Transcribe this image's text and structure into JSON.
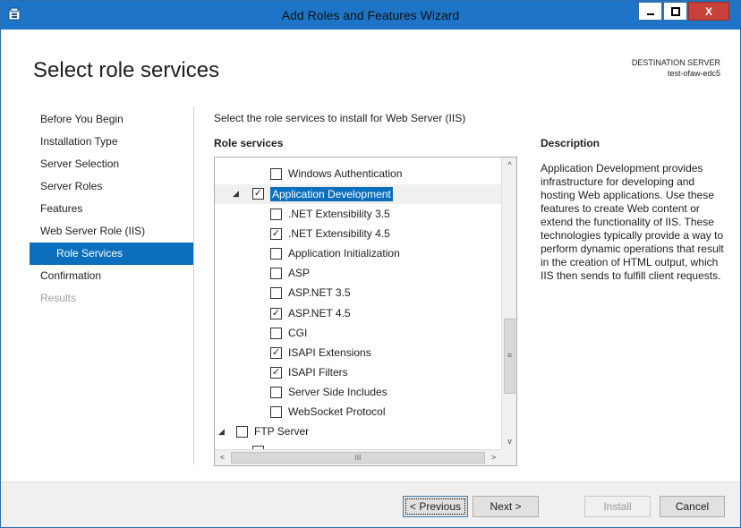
{
  "window": {
    "title": "Add Roles and Features Wizard",
    "min_label": "▁",
    "max_label": "☐",
    "close_label": "X"
  },
  "header": {
    "title": "Select role services",
    "destination_label": "DESTINATION SERVER",
    "destination_name": "test-ofaw-edc5"
  },
  "nav": {
    "items": [
      {
        "label": "Before You Begin"
      },
      {
        "label": "Installation Type"
      },
      {
        "label": "Server Selection"
      },
      {
        "label": "Server Roles"
      },
      {
        "label": "Features"
      },
      {
        "label": "Web Server Role (IIS)"
      },
      {
        "label": "Role Services"
      },
      {
        "label": "Confirmation"
      },
      {
        "label": "Results"
      }
    ]
  },
  "main": {
    "instruction": "Select the role services to install for Web Server (IIS)",
    "role_services_header": "Role services",
    "description_header": "Description",
    "description": "Application Development provides infrastructure for developing and hosting Web applications. Use these features to create Web content or extend the functionality of IIS. These technologies typically provide a way to perform dynamic operations that result in the creation of HTML output, which IIS then sends to fulfill client requests.",
    "tree": [
      {
        "label": "Windows Authentication",
        "checked": false
      },
      {
        "label": "Application Development",
        "checked": true,
        "expander": "◢"
      },
      {
        "label": ".NET Extensibility 3.5",
        "checked": false
      },
      {
        "label": ".NET Extensibility 4.5",
        "checked": true
      },
      {
        "label": "Application Initialization",
        "checked": false
      },
      {
        "label": "ASP",
        "checked": false
      },
      {
        "label": "ASP.NET 3.5",
        "checked": false
      },
      {
        "label": "ASP.NET 4.5",
        "checked": true
      },
      {
        "label": "CGI",
        "checked": false
      },
      {
        "label": "ISAPI Extensions",
        "checked": true
      },
      {
        "label": "ISAPI Filters",
        "checked": true
      },
      {
        "label": "Server Side Includes",
        "checked": false
      },
      {
        "label": "WebSocket Protocol",
        "checked": false
      },
      {
        "label": "FTP Server",
        "checked": false,
        "expander": "◢"
      }
    ],
    "scroll_glyphs": {
      "up": "^",
      "down": "v",
      "left": "<",
      "right": ">",
      "grip": "≡",
      "hgrip": "III"
    }
  },
  "footer": {
    "previous": "< Previous",
    "previous_key": "P",
    "next": "Next >",
    "install": "Install",
    "cancel": "Cancel"
  },
  "colors": {
    "accent": "#0b6fbd",
    "titlebar": "#1e75c8",
    "close": "#c7403a"
  }
}
